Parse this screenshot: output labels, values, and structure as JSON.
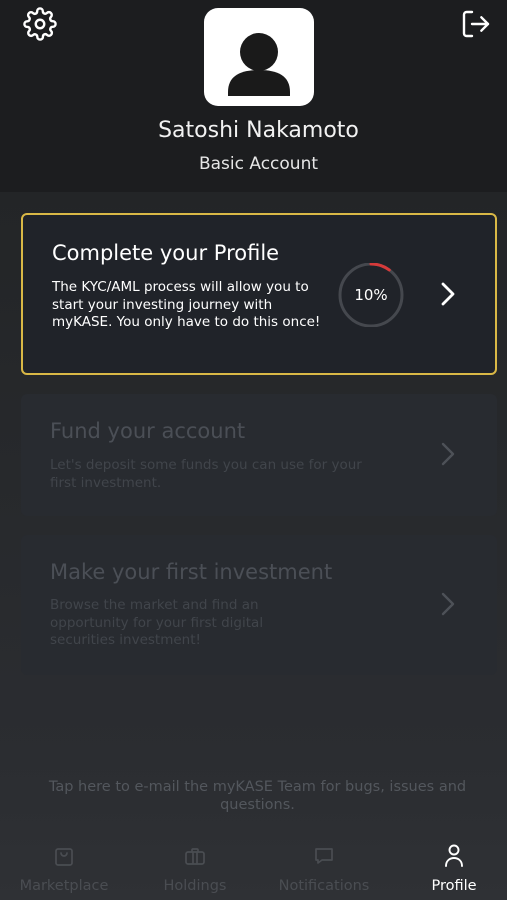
{
  "header": {
    "user_name": "Satoshi Nakamoto",
    "account_type": "Basic Account",
    "icons": [
      "gear-icon",
      "logout-icon",
      "user-avatar-icon"
    ]
  },
  "cards": [
    {
      "title": "Complete your Profile",
      "description": "The KYC/AML process will allow you to start your investing journey with myKASE. You only have to do this once!",
      "progress_label": "10%",
      "progress_value": 0.1,
      "state": "active"
    },
    {
      "title": "Fund your account",
      "description": "Let's deposit some funds you can use for your first investment.",
      "state": "disabled"
    },
    {
      "title": "Make your first investment",
      "description": "Browse the market and find an opportunity for your first digital securities investment!",
      "state": "disabled"
    }
  ],
  "footer_note": "Tap here to e-mail the myKASE Team for bugs, issues and questions.",
  "tabs": [
    {
      "label": "Marketplace",
      "icon": "shopping-bag-icon",
      "active": false
    },
    {
      "label": "Holdings",
      "icon": "briefcase-icon",
      "active": false
    },
    {
      "label": "Notifications",
      "icon": "chat-bubble-icon",
      "active": false
    },
    {
      "label": "Profile",
      "icon": "person-icon",
      "active": true
    }
  ],
  "colors": {
    "accent_border": "#d9b846",
    "progress_arc": "#d63a3a",
    "background": "#1c1d1f",
    "card": "#22252b"
  }
}
